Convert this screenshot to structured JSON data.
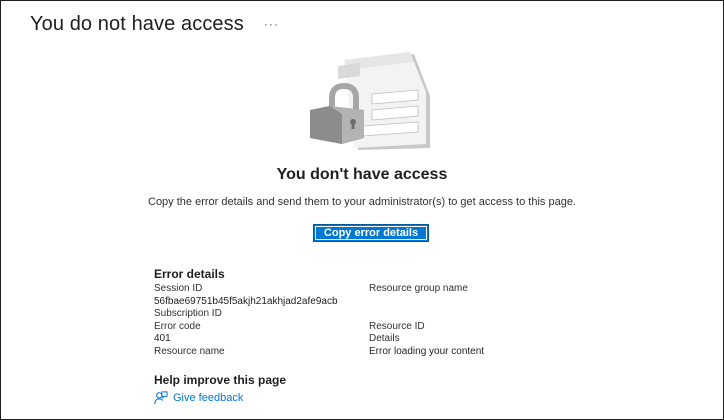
{
  "header": {
    "title": "You do not have access",
    "more_label": "···"
  },
  "message": {
    "headline": "You don't have access",
    "body": "Copy the error details and send them to your administrator(s) to get access to this page.",
    "copy_button": "Copy error details"
  },
  "error_details": {
    "title": "Error details",
    "left": [
      {
        "label": "Session ID",
        "value": "56fbae69751b45f5akjh21akhjad2afe9acb"
      },
      {
        "label": "Subscription ID",
        "value": ""
      },
      {
        "label": "Error code",
        "value": "401"
      },
      {
        "label": "Resource name",
        "value": ""
      }
    ],
    "right": [
      {
        "label": "Resource group name",
        "value": ""
      },
      {
        "label": "Resource ID",
        "value": ""
      },
      {
        "label": "Details",
        "value": "Error loading your content"
      }
    ]
  },
  "help": {
    "title": "Help improve this page",
    "feedback_label": "Give feedback"
  },
  "icons": {
    "more": "more-icon",
    "illustration": "lock-illustration-icon",
    "feedback": "feedback-person-icon"
  },
  "colors": {
    "accent": "#0078d4",
    "text": "#323130"
  }
}
